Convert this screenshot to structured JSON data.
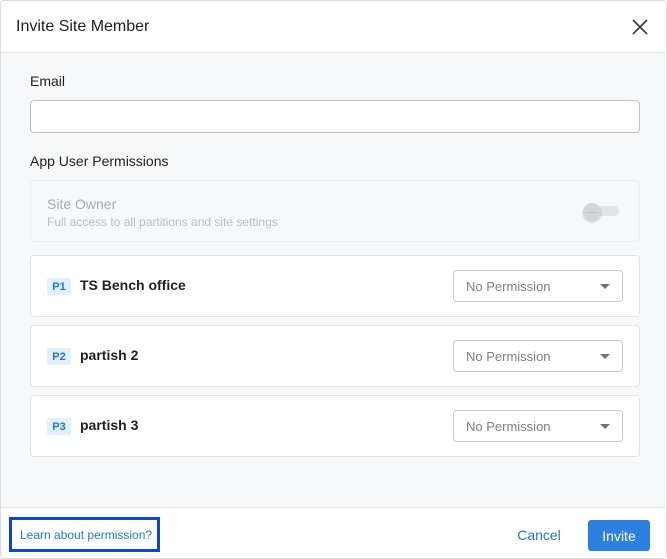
{
  "dialog": {
    "title": "Invite Site Member",
    "close_icon": "close-icon"
  },
  "email": {
    "label": "Email",
    "value": "",
    "placeholder": ""
  },
  "permissions": {
    "label": "App User Permissions",
    "site_owner": {
      "title": "Site Owner",
      "description": "Full access to all partitions and site settings",
      "enabled": false,
      "disabled": true
    },
    "partitions": [
      {
        "badge": "P1",
        "name": "TS Bench office",
        "permission": "No Permission"
      },
      {
        "badge": "P2",
        "name": "partish 2",
        "permission": "No Permission"
      },
      {
        "badge": "P3",
        "name": "partish 3",
        "permission": "No Permission"
      }
    ]
  },
  "footer": {
    "learn_link": "Learn about permission?",
    "cancel_label": "Cancel",
    "invite_label": "Invite"
  },
  "colors": {
    "accent": "#2d80e0",
    "link": "#1f76d3",
    "highlight_border": "#0d47c9",
    "badge_bg": "#e3effc"
  }
}
